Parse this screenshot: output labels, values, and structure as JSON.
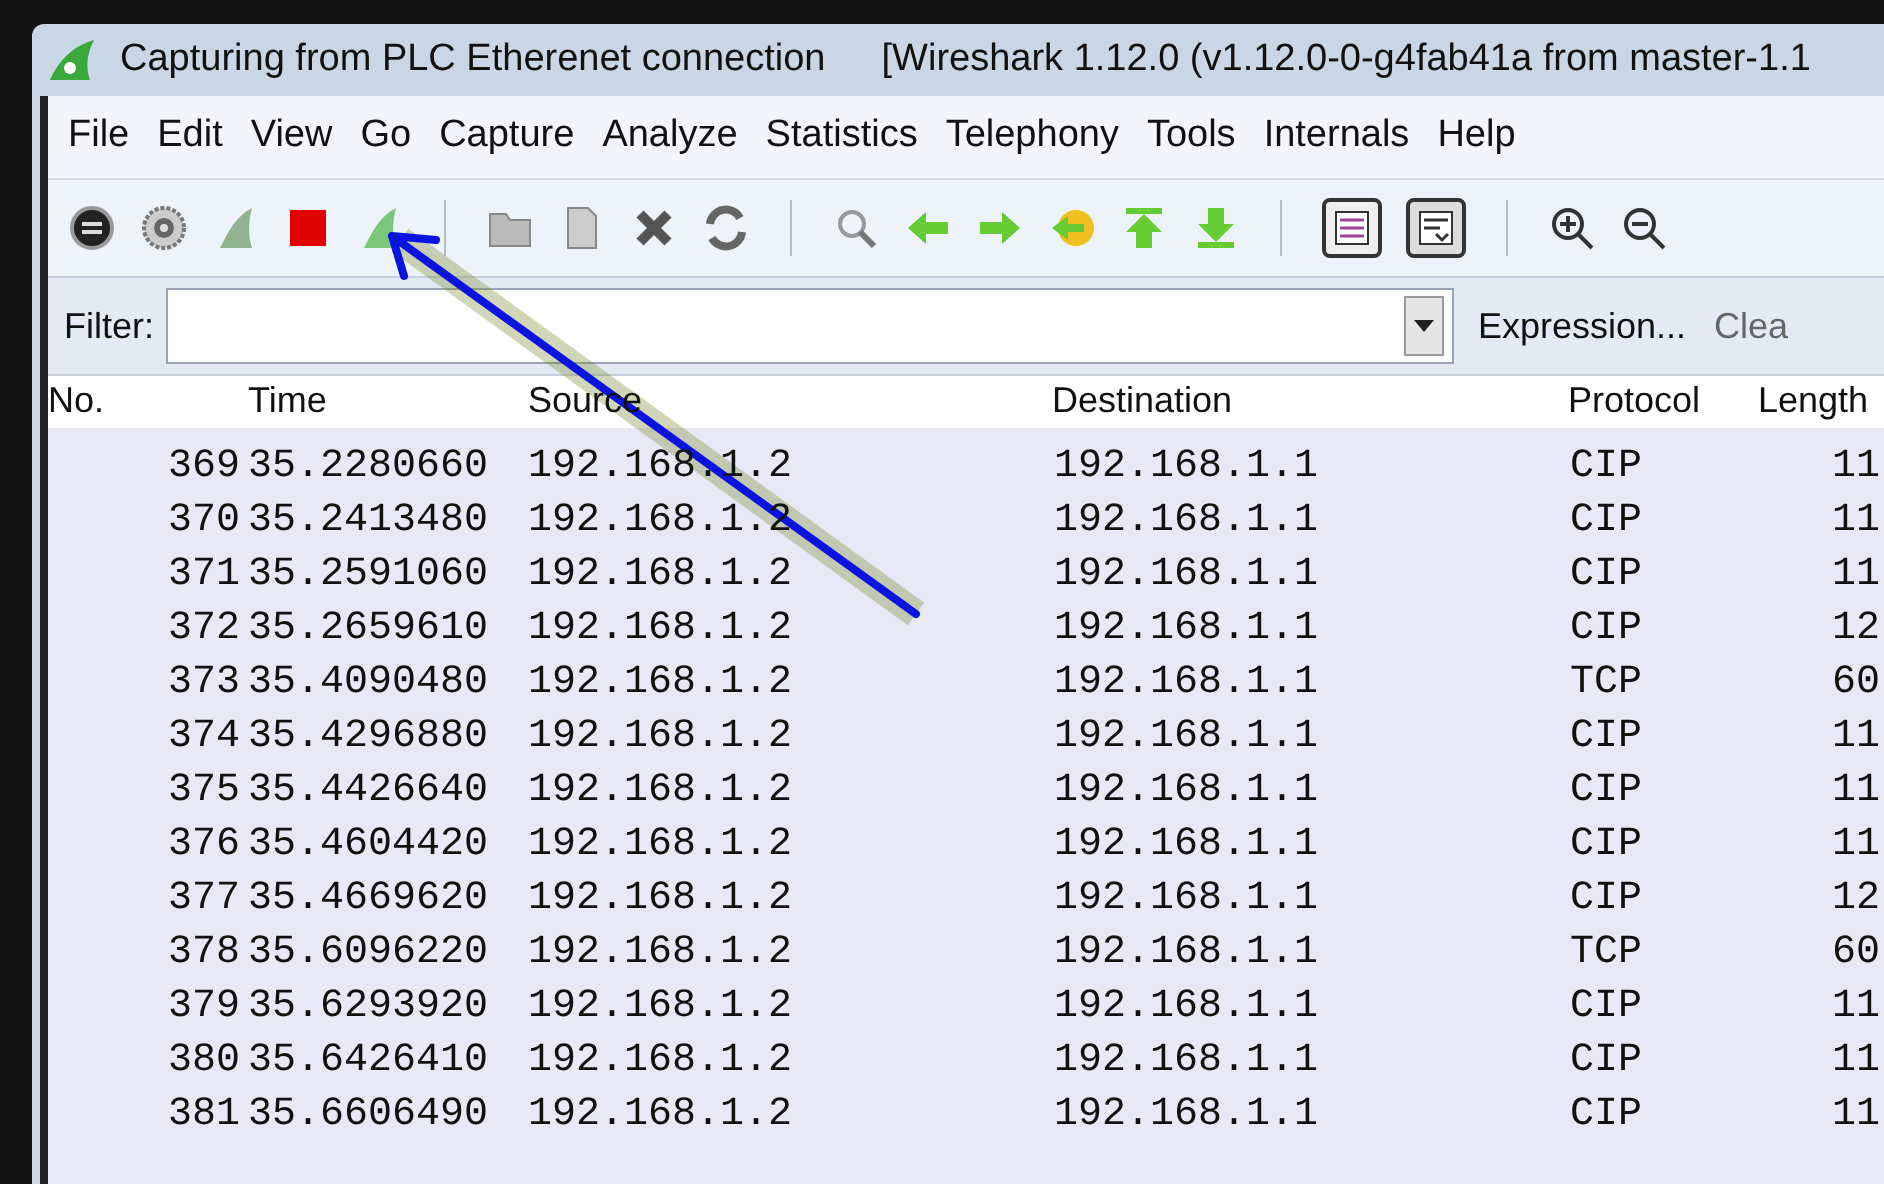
{
  "window": {
    "title": "Capturing from PLC Etherenet connection",
    "subtitle": "[Wireshark 1.12.0  (v1.12.0-0-g4fab41a from master-1.1"
  },
  "menu": [
    "File",
    "Edit",
    "View",
    "Go",
    "Capture",
    "Analyze",
    "Statistics",
    "Telephony",
    "Tools",
    "Internals",
    "Help"
  ],
  "toolbar": [
    {
      "kind": "interfaces"
    },
    {
      "kind": "options"
    },
    {
      "kind": "start"
    },
    {
      "kind": "stop"
    },
    {
      "kind": "restart"
    },
    {
      "kind": "sep"
    },
    {
      "kind": "open"
    },
    {
      "kind": "save"
    },
    {
      "kind": "close"
    },
    {
      "kind": "reload"
    },
    {
      "kind": "sep"
    },
    {
      "kind": "find"
    },
    {
      "kind": "back"
    },
    {
      "kind": "forward"
    },
    {
      "kind": "goto"
    },
    {
      "kind": "first"
    },
    {
      "kind": "last"
    },
    {
      "kind": "sep"
    },
    {
      "kind": "colorize"
    },
    {
      "kind": "autoscroll"
    },
    {
      "kind": "sep"
    },
    {
      "kind": "zoomin"
    },
    {
      "kind": "zoomout"
    }
  ],
  "filter": {
    "label": "Filter:",
    "expression": "Expression...",
    "clear": "Clea"
  },
  "table": {
    "columns": [
      "No.",
      "Time",
      "Source",
      "Destination",
      "Protocol",
      "Length"
    ],
    "rows": [
      [
        "369",
        "35.2280660",
        "192.168.1.2",
        "192.168.1.1",
        "CIP",
        "11"
      ],
      [
        "370",
        "35.2413480",
        "192.168.1.2",
        "192.168.1.1",
        "CIP",
        "11"
      ],
      [
        "371",
        "35.2591060",
        "192.168.1.2",
        "192.168.1.1",
        "CIP",
        "11"
      ],
      [
        "372",
        "35.2659610",
        "192.168.1.2",
        "192.168.1.1",
        "CIP",
        "12"
      ],
      [
        "373",
        "35.4090480",
        "192.168.1.2",
        "192.168.1.1",
        "TCP",
        "60"
      ],
      [
        "374",
        "35.4296880",
        "192.168.1.2",
        "192.168.1.1",
        "CIP",
        "11"
      ],
      [
        "375",
        "35.4426640",
        "192.168.1.2",
        "192.168.1.1",
        "CIP",
        "11"
      ],
      [
        "376",
        "35.4604420",
        "192.168.1.2",
        "192.168.1.1",
        "CIP",
        "11"
      ],
      [
        "377",
        "35.4669620",
        "192.168.1.2",
        "192.168.1.1",
        "CIP",
        "12"
      ],
      [
        "378",
        "35.6096220",
        "192.168.1.2",
        "192.168.1.1",
        "TCP",
        "60"
      ],
      [
        "379",
        "35.6293920",
        "192.168.1.2",
        "192.168.1.1",
        "CIP",
        "11"
      ],
      [
        "380",
        "35.6426410",
        "192.168.1.2",
        "192.168.1.1",
        "CIP",
        "11"
      ],
      [
        "381",
        "35.6606490",
        "192.168.1.2",
        "192.168.1.1",
        "CIP",
        "11"
      ]
    ]
  }
}
